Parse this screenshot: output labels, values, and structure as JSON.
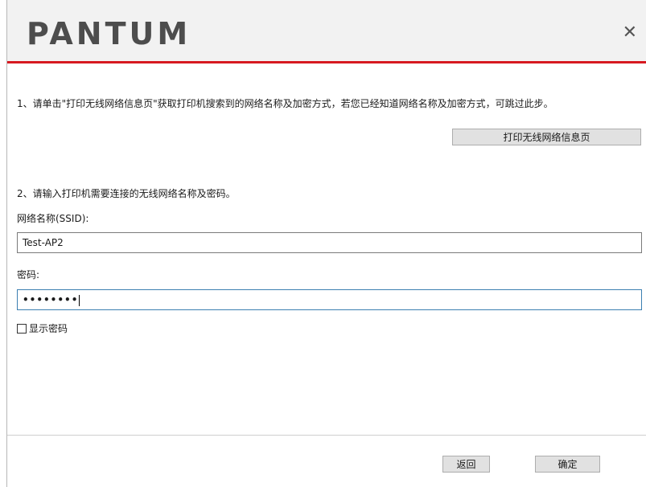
{
  "app": {
    "logo_text": "PANTUM",
    "close_symbol": "✕",
    "accent_color": "#d71920"
  },
  "step1": {
    "instruction": "1、请单击\"打印无线网络信息页\"获取打印机搜索到的网络名称及加密方式，若您已经知道网络名称及加密方式，可跳过此步。",
    "print_button_label": "打印无线网络信息页"
  },
  "step2": {
    "instruction": "2、请输入打印机需要连接的无线网络名称及密码。",
    "ssid_label": "网络名称(SSID):",
    "ssid_value": "Test-AP2",
    "password_label": "密码:",
    "password_value": "••••••••",
    "show_password_label": "显示密码",
    "show_password_checked": false
  },
  "footer": {
    "back_button_label": "返回",
    "ok_button_label": "确定"
  }
}
